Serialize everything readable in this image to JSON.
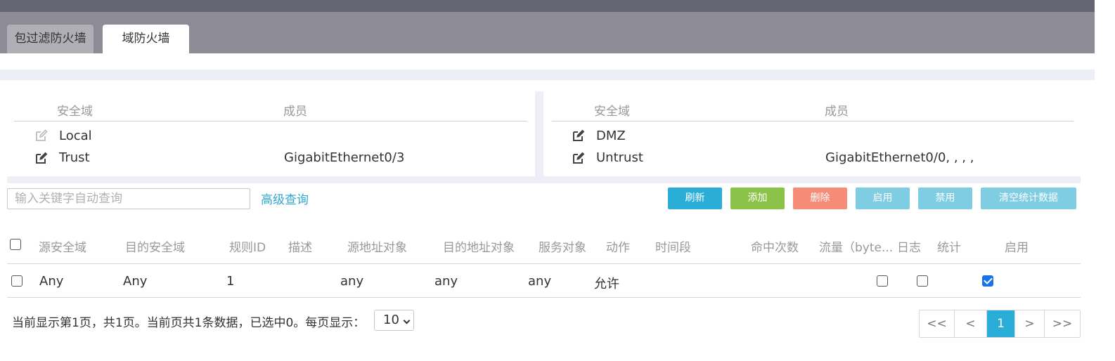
{
  "tabs": [
    {
      "label": "包过滤防火墙",
      "active": false
    },
    {
      "label": "域防火墙",
      "active": true
    }
  ],
  "zones_left": {
    "headers": {
      "zone": "安全域",
      "member": "成员"
    },
    "rows": [
      {
        "zone": "Local",
        "member": "",
        "editable": false
      },
      {
        "zone": "Trust",
        "member": "GigabitEthernet0/3",
        "editable": true
      }
    ]
  },
  "zones_right": {
    "headers": {
      "zone": "安全域",
      "member": "成员"
    },
    "rows": [
      {
        "zone": "DMZ",
        "member": "",
        "editable": true
      },
      {
        "zone": "Untrust",
        "member": "GigabitEthernet0/0, , , ,",
        "editable": true
      }
    ]
  },
  "search": {
    "placeholder": "输入关键字自动查询",
    "value": ""
  },
  "advanced_query": "高级查询",
  "toolbar": {
    "refresh": "刷新",
    "add": "添加",
    "delete": "删除",
    "enable": "启用",
    "disable": "禁用",
    "clear_stats": "清空统计数据"
  },
  "colors": {
    "refresh": "#2aaed8",
    "add": "#8bc34a",
    "delete": "#f68b78",
    "enable": "#7fcde3",
    "disable": "#7fcde3",
    "clear_stats": "#7fcde3",
    "accent": "#2aaed8"
  },
  "table": {
    "columns": [
      "源安全域",
      "目的安全域",
      "规则ID",
      "描述",
      "源地址对象",
      "目的地址对象",
      "服务对象",
      "动作",
      "时间段",
      "命中次数",
      "流量（byte...",
      "日志",
      "统计",
      "启用"
    ],
    "rows": [
      {
        "src_zone": "Any",
        "dst_zone": "Any",
        "rule_id": "1",
        "description": "",
        "src_addr": "any",
        "dst_addr": "any",
        "service": "any",
        "action": "允许",
        "time_range": "",
        "hits": "",
        "traffic": "",
        "log": false,
        "stats": false,
        "enabled": true
      }
    ]
  },
  "pagination": {
    "summary": "当前显示第1页，共1页。当前页共1条数据，已选中0。每页显示：",
    "page_size": "10",
    "first": "<<",
    "prev": "<",
    "current": "1",
    "next": ">",
    "last": ">>"
  }
}
